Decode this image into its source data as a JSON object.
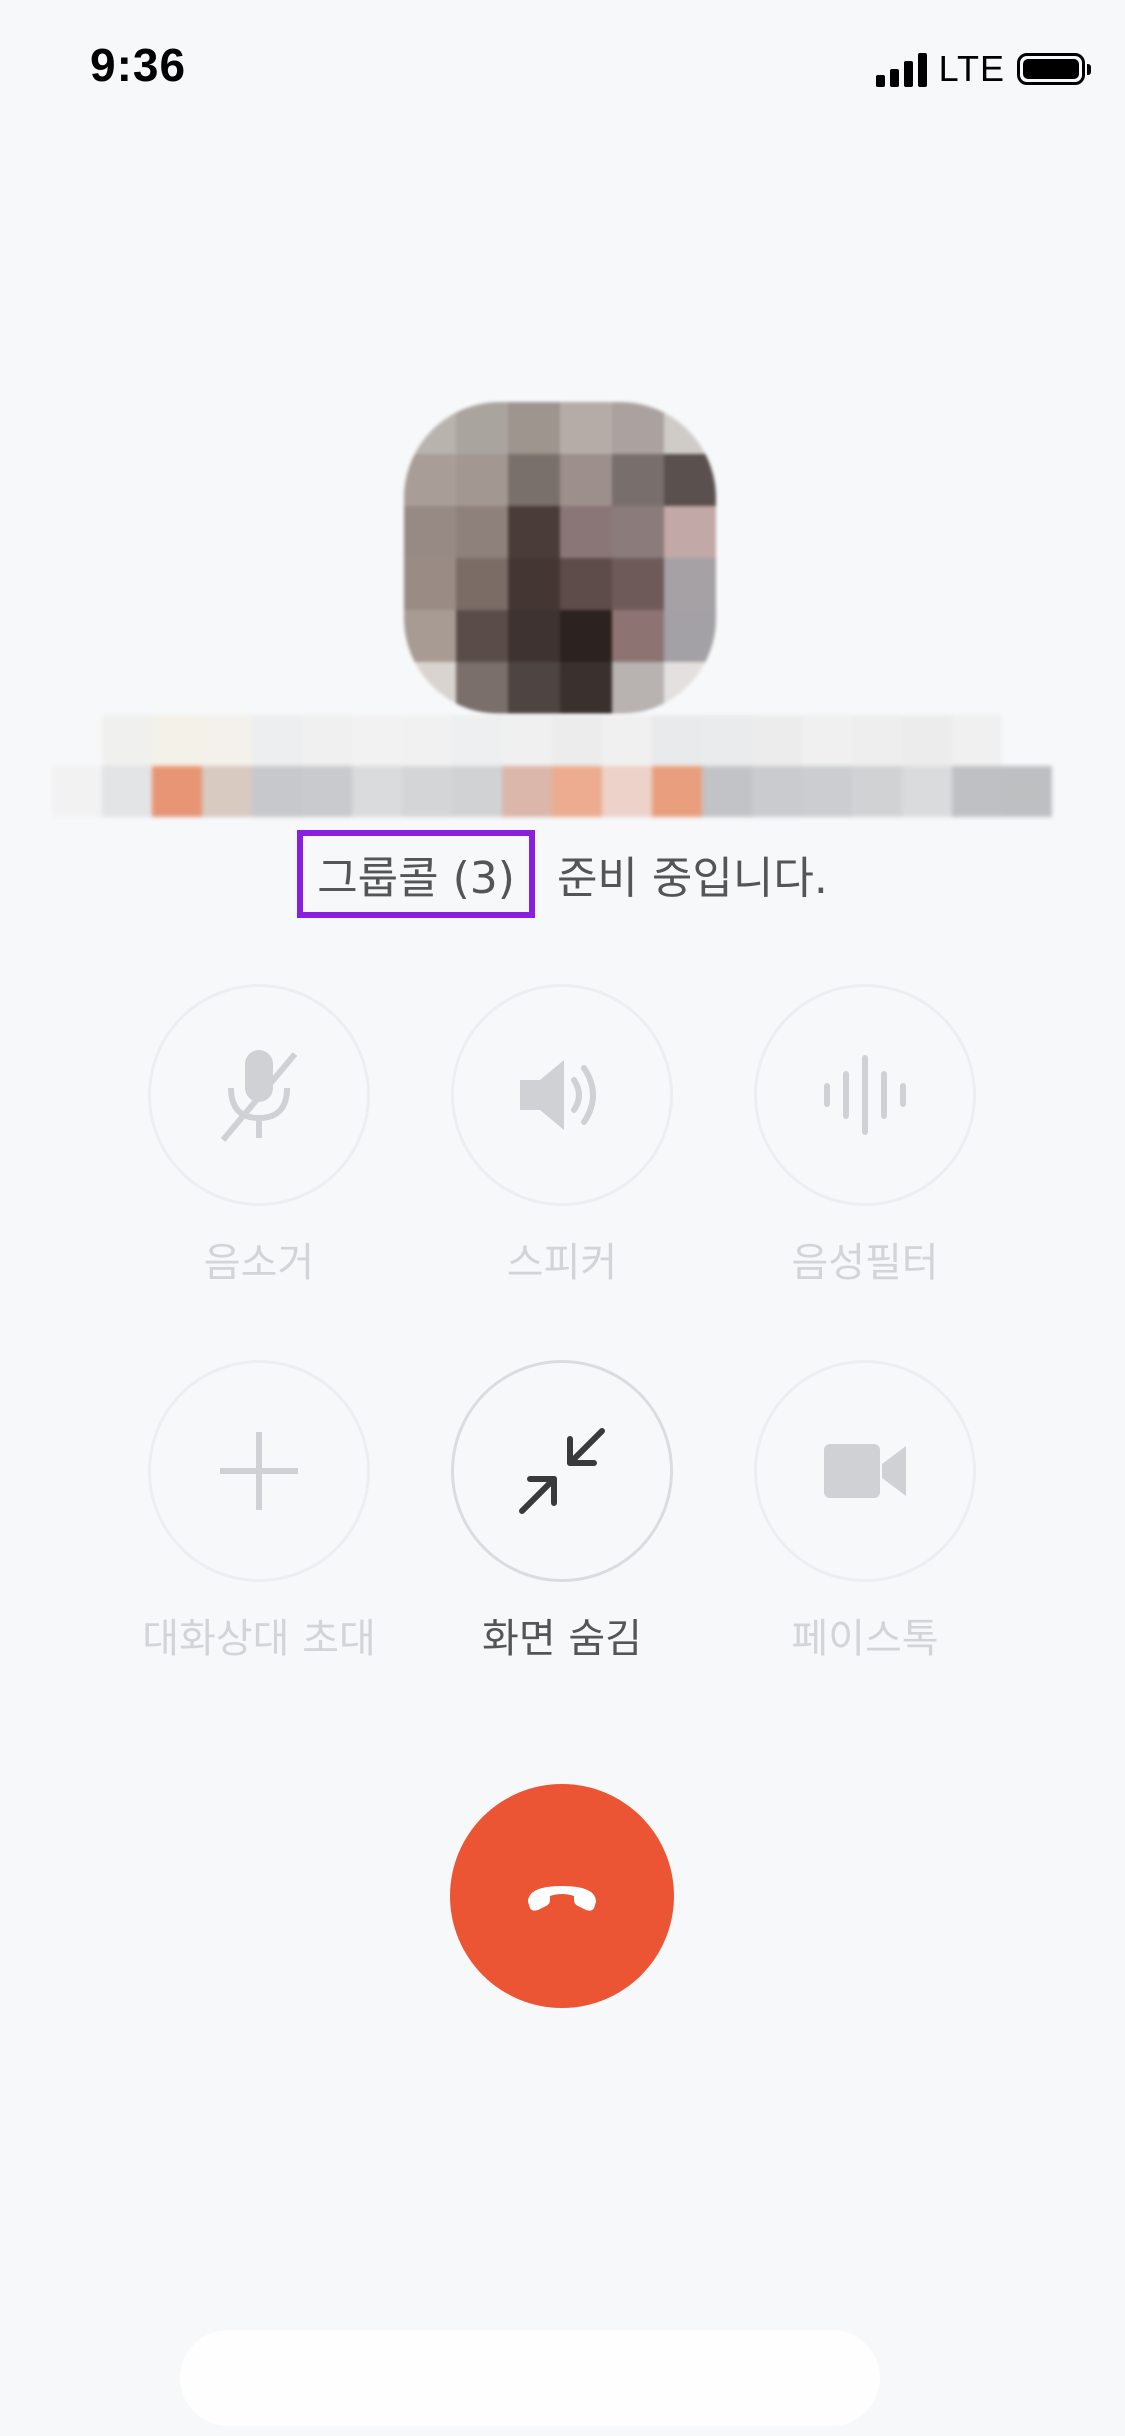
{
  "status_bar": {
    "time": "9:36",
    "network": "LTE"
  },
  "call": {
    "group_call_label": "그룹콜 (3)",
    "status_suffix": "준비 중입니다."
  },
  "controls": [
    {
      "label": "음소거",
      "icon": "mic-off-icon",
      "active": false
    },
    {
      "label": "스피커",
      "icon": "speaker-icon",
      "active": false
    },
    {
      "label": "음성필터",
      "icon": "voice-filter-icon",
      "active": false
    },
    {
      "label": "대화상대 초대",
      "icon": "plus-icon",
      "active": false
    },
    {
      "label": "화면 숨김",
      "icon": "minimize-icon",
      "active": true
    },
    {
      "label": "페이스톡",
      "icon": "video-icon",
      "active": false
    }
  ],
  "colors": {
    "end_call": "#ec5534",
    "highlight_box": "#8b1fe0",
    "background": "#f7f8fa"
  }
}
